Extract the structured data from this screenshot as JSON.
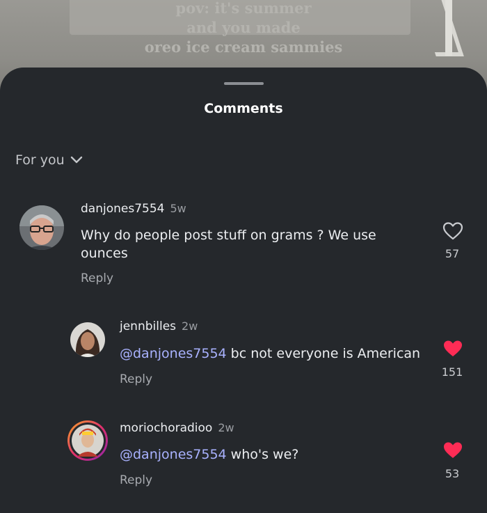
{
  "video": {
    "caption_lines": [
      "pov: it's summer",
      "and you made",
      "oreo ice cream sammies"
    ]
  },
  "sheet": {
    "title": "Comments",
    "filter_label": "For you"
  },
  "comments": [
    {
      "username": "danjones7554",
      "time": "5w",
      "mention": "",
      "text": "Why do people post stuff on grams ? We use ounces",
      "reply_label": "Reply",
      "likes": "57",
      "liked": false
    },
    {
      "username": "jennbilles",
      "time": "2w",
      "mention": "@danjones7554",
      "text": " bc not everyone is American",
      "reply_label": "Reply",
      "likes": "151",
      "liked": true
    },
    {
      "username": "moriochoradioo",
      "time": "2w",
      "mention": "@danjones7554",
      "text": " who's we?",
      "reply_label": "Reply",
      "likes": "53",
      "liked": true
    }
  ],
  "colors": {
    "sheet": "#25282c",
    "heart_active": "#fe2c55",
    "mention": "#a9b2ff"
  },
  "icons": {
    "filter_chevron": "chevron-down-icon",
    "like_outline": "heart-outline-icon",
    "like_filled": "heart-filled-icon"
  }
}
